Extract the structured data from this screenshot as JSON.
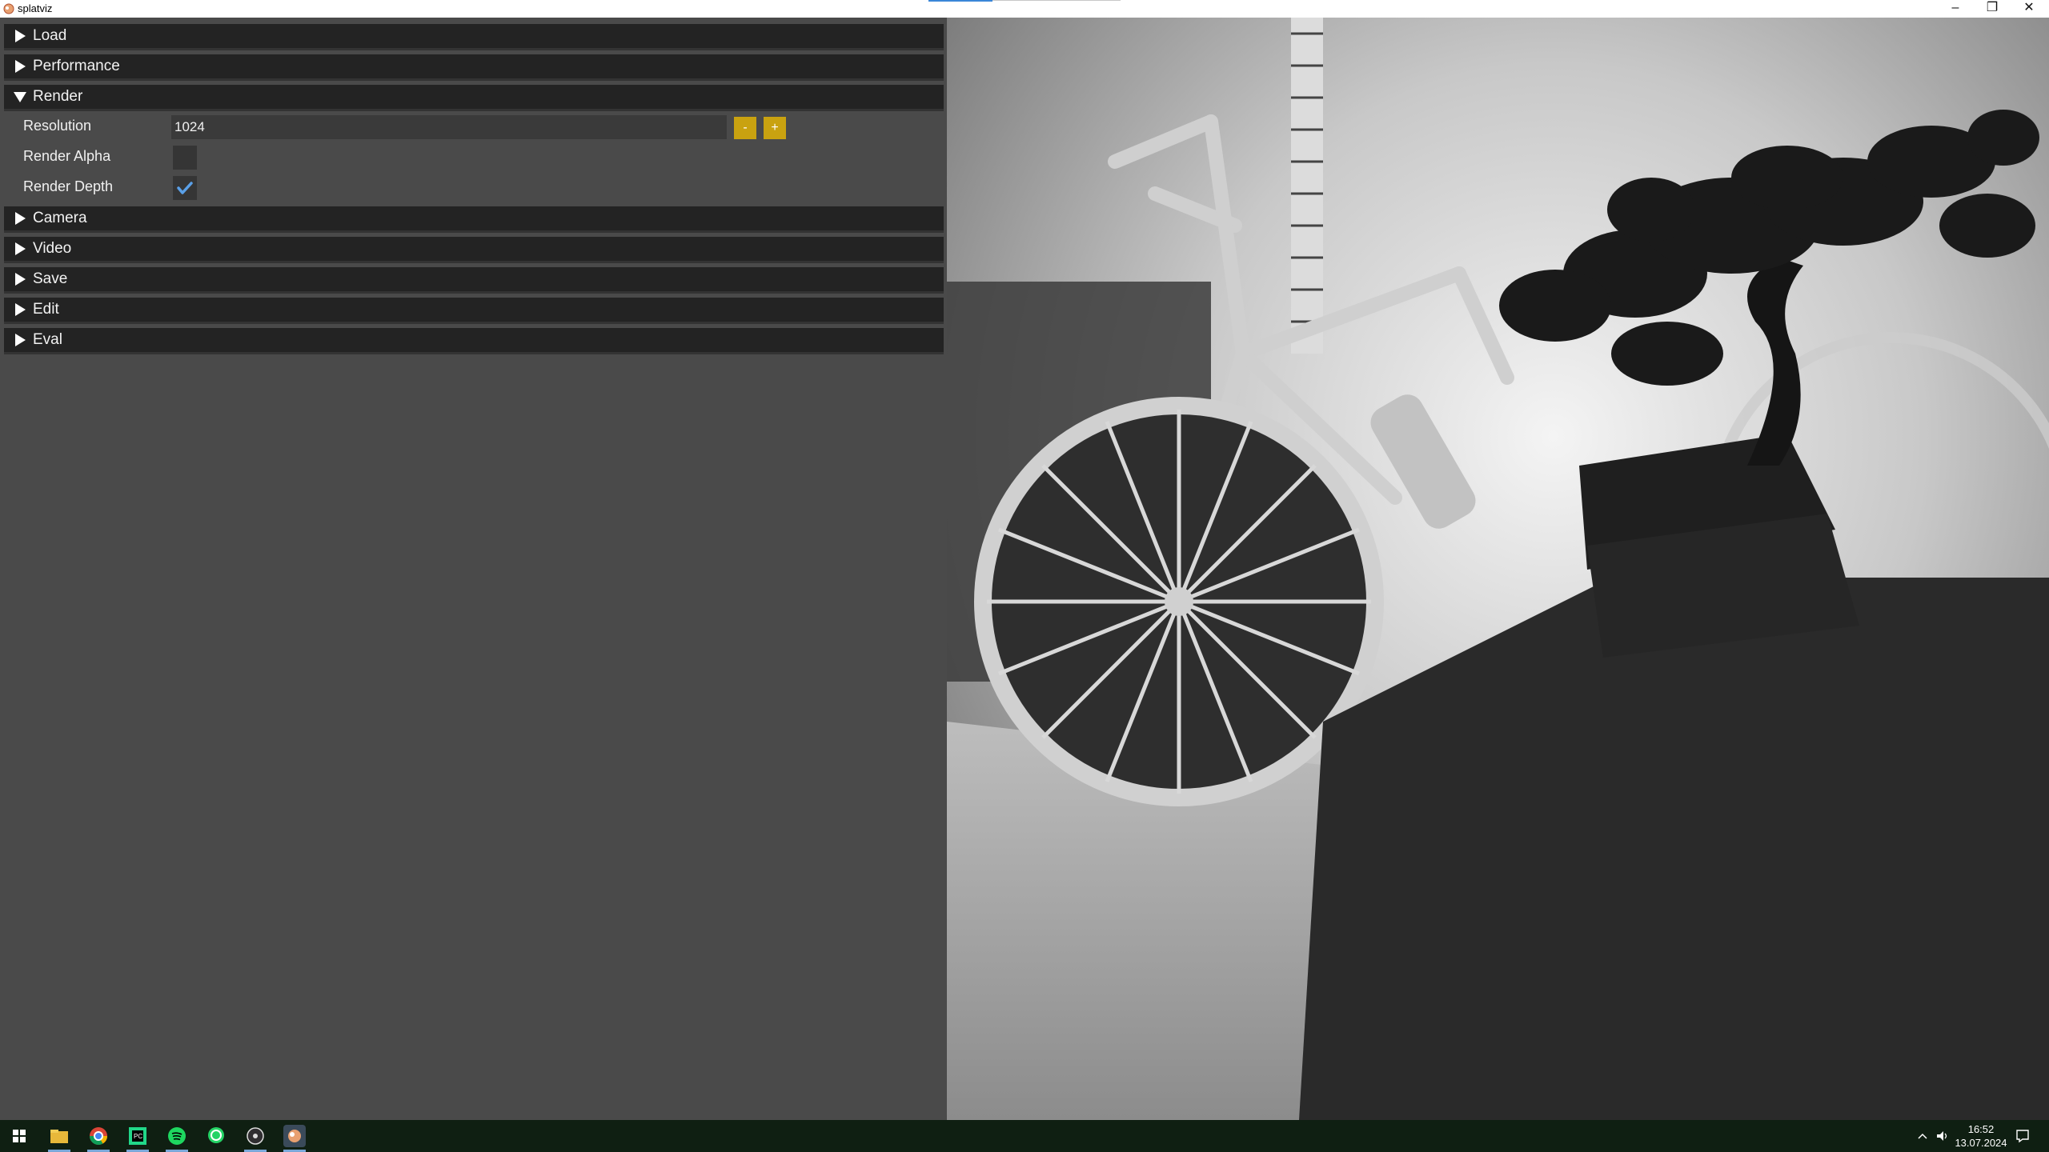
{
  "window": {
    "title": "splatviz"
  },
  "panel": {
    "sections": [
      {
        "label": "Load",
        "expanded": false
      },
      {
        "label": "Performance",
        "expanded": false
      },
      {
        "label": "Render",
        "expanded": true
      },
      {
        "label": "Camera",
        "expanded": false
      },
      {
        "label": "Video",
        "expanded": false
      },
      {
        "label": "Save",
        "expanded": false
      },
      {
        "label": "Edit",
        "expanded": false
      },
      {
        "label": "Eval",
        "expanded": false
      }
    ],
    "render": {
      "resolution_label": "Resolution",
      "resolution_value": "1024",
      "minus_label": "-",
      "plus_label": "+",
      "alpha_label": "Render Alpha",
      "alpha_checked": false,
      "depth_label": "Render Depth",
      "depth_checked": true
    }
  },
  "taskbar": {
    "apps": [
      "windows-start",
      "file-explorer",
      "chrome",
      "pycharm",
      "spotify",
      "whatsapp",
      "obs",
      "splatviz"
    ],
    "time": "16:52",
    "date": "13.07.2024"
  },
  "colors": {
    "accent_button": "#c9a210",
    "header_bg": "#232323",
    "panel_bg": "#4a4a4a",
    "checkmark": "#5aa0e8"
  }
}
